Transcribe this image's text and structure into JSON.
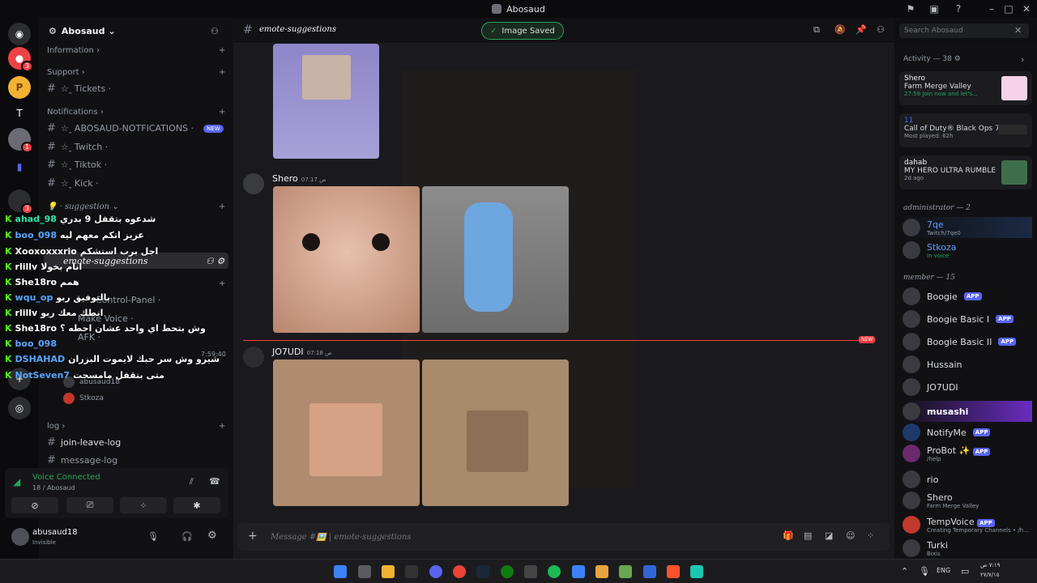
{
  "window": {
    "title": "Abosaud"
  },
  "toast": {
    "label": "Image Saved"
  },
  "server": {
    "name": "Abosaud"
  },
  "rail": {
    "badges": [
      "3",
      "1",
      "3"
    ],
    "letter_item": "T"
  },
  "sidebar": {
    "categories": {
      "information": "Information ›",
      "support": "Support ›",
      "notifications": "Notifications ›",
      "suggestion": "💡 · suggestion ⌄",
      "log": "log ›"
    },
    "channels": {
      "tickets": "☆ꞈ Tickets ·",
      "abosaud_notifications": "☆ꞈ ABOSAUD-NOTFICATIONS ·",
      "twitch": "☆ꞈ Twitch ·",
      "tiktok": "☆ꞈ Tiktok ·",
      "kick": "☆ꞈ Kick ·",
      "emote_suggestions": "emote-suggestions",
      "control_panel": "Control-Panel ·",
      "make_voice": "Make Voice ·",
      "afk": "AFK ·",
      "join_leave_log": "join-leave-log",
      "message_log": "message-log"
    },
    "new_pill": "NEW",
    "voice_users": [
      "abusaud18",
      "Stkoza"
    ],
    "voice_timer": "7:59:40"
  },
  "voice": {
    "status": "Voice Connected",
    "channel": "18 / Abosaud"
  },
  "user": {
    "name": "abusaud18",
    "status": "Invisible"
  },
  "chat_overlay": [
    {
      "user": "ahad_98",
      "text": "شدعوه بتقفل 9 بدري",
      "color": "#2ee6a8"
    },
    {
      "user": "boo_098",
      "text": "عزيز اتكم معهم ليه",
      "color": "#58a6ff"
    },
    {
      "user": "Xooxoxxxrio",
      "text": "اجل برب استشكم",
      "color": "#ffffff"
    },
    {
      "user": "rlillv",
      "text": "انام بخولا",
      "color": "#ffffff"
    },
    {
      "user": "She18ro",
      "text": "همم",
      "color": "#ffffff"
    },
    {
      "user": "wqu_op",
      "text": "بالتوفيق ربو",
      "color": "#58a6ff"
    },
    {
      "user": "rlillv",
      "text": "انطك معك ربو",
      "color": "#ffffff"
    },
    {
      "user": "She18ro",
      "text": "وش بتحط اي واحد عشان احطه ؟",
      "color": "#ffffff"
    },
    {
      "user": "boo_098",
      "text": "",
      "color": "#58a6ff"
    },
    {
      "user": "DSHAHAD",
      "text": "شيرو وش سر حبك لايموت البزران",
      "color": "#58a6ff"
    },
    {
      "user": "NotSeven7",
      "text": "متى بتقفل مامسحت",
      "color": "#58a6ff"
    }
  ],
  "channel": {
    "name": "emote-suggestions",
    "search_placeholder": "Search Abosaud"
  },
  "messages": [
    {
      "author": "Shero",
      "time": "07:17 ص"
    },
    {
      "author": "JO7UDI",
      "time": "07:18 ص"
    }
  ],
  "new_divider": "NEW",
  "composer": {
    "placeholder": "Message #🖼️ | emote-suggestions"
  },
  "activity": {
    "header": "Activity — 38",
    "cards": [
      {
        "name": "Shero",
        "game": "Farm Merge Valley",
        "detail": "27:58  Join now and let's..."
      },
      {
        "name": "11",
        "game": "Call of Duty® Black Ops 7",
        "detail": "Most played: 62h"
      },
      {
        "name": "dahab",
        "game": "MY HERO ULTRA RUMBLE",
        "detail": "2d ago"
      }
    ]
  },
  "members": {
    "admin_header": "administrator — 2",
    "admins": [
      {
        "name": "7qe",
        "sub": "Twitch/7qe0"
      },
      {
        "name": "Stkoza",
        "sub": "In voice"
      }
    ],
    "member_header": "member — 15",
    "list": [
      {
        "name": "Boogie",
        "app": "APP",
        "sub": ""
      },
      {
        "name": "Boogie Basic I",
        "app": "APP",
        "sub": ""
      },
      {
        "name": "Boogie Basic II",
        "app": "APP",
        "sub": ""
      },
      {
        "name": "Hussain",
        "app": "",
        "sub": ""
      },
      {
        "name": "JO7UDI",
        "app": "",
        "sub": ""
      },
      {
        "name": "musashi",
        "app": "",
        "sub": ""
      },
      {
        "name": "NotifyMe",
        "app": "APP",
        "sub": ""
      },
      {
        "name": "ProBot ✨",
        "app": "APP",
        "sub": "/help"
      },
      {
        "name": "rio",
        "app": "",
        "sub": ""
      },
      {
        "name": "Shero",
        "app": "",
        "sub": "Farm Merge Valley"
      },
      {
        "name": "TempVoice",
        "app": "APP",
        "sub": "Creating Temporary Channels • /h..."
      },
      {
        "name": "Turki",
        "app": "",
        "sub": "Bixis"
      }
    ]
  },
  "taskbar": {
    "lang": "ENG",
    "time": "٧:١٩ ص",
    "date": "٢٧/٧/١٥"
  },
  "colors": {
    "accent": "#5865f2",
    "online": "#23a55a",
    "kick_green": "#53fc18",
    "new_red": "#f23f43"
  }
}
